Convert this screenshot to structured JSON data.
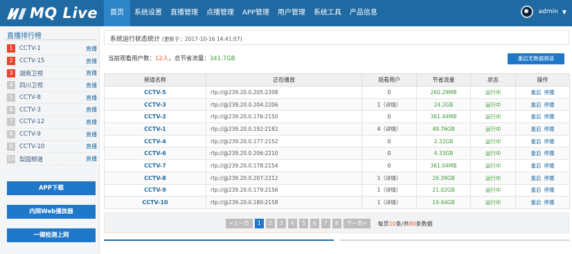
{
  "app": {
    "logo_text": "MQ Live"
  },
  "nav": {
    "items": [
      {
        "label": "首页",
        "active": true
      },
      {
        "label": "系统设置"
      },
      {
        "label": "直播管理"
      },
      {
        "label": "点播管理"
      },
      {
        "label": "APP管理"
      },
      {
        "label": "用户管理"
      },
      {
        "label": "系统工具"
      },
      {
        "label": "产品信息"
      }
    ],
    "username": "admin"
  },
  "sidebar": {
    "title": "直播排行榜",
    "ranks": [
      {
        "num": "1",
        "name": "CCTV-1",
        "link": "直播"
      },
      {
        "num": "2",
        "name": "CCTV-15",
        "link": "直播"
      },
      {
        "num": "3",
        "name": "湖南卫视",
        "link": "直播"
      },
      {
        "num": "4",
        "name": "四川卫视",
        "link": "直播"
      },
      {
        "num": "5",
        "name": "CCTV-8",
        "link": "直播"
      },
      {
        "num": "6",
        "name": "CCTV-3",
        "link": "直播"
      },
      {
        "num": "7",
        "name": "CCTV-12",
        "link": "直播"
      },
      {
        "num": "8",
        "name": "CCTV-9",
        "link": "直播"
      },
      {
        "num": "9",
        "name": "CCTV-10",
        "link": "直播"
      },
      {
        "num": "10",
        "name": "梨园频道",
        "link": "直播"
      }
    ],
    "buttons": [
      "APP下载",
      "内网Web播放器",
      "一键检测上网"
    ]
  },
  "main": {
    "title": "系统运行状态统计",
    "timestamp": "(更新于：2017-10-16 14:41:07)",
    "summary": {
      "prefix": "当前观看用户数：",
      "users": "12人",
      "mid": "，总节省流量：",
      "traffic": "341.7GB"
    },
    "restart_button": "重启无数据频道",
    "table": {
      "headers": [
        "频道名称",
        "正在播放",
        "观看用户",
        "节省流量",
        "状态",
        "操作"
      ],
      "rows": [
        {
          "channel": "CCTV-5",
          "url": "rtp://@239.20.0.205:2208",
          "users": "0",
          "traffic": "260.29MB",
          "status": "运行中"
        },
        {
          "channel": "CCTV-3",
          "url": "rtp://@239.20.0.204:2206",
          "users": "1（详情）",
          "traffic": "24.2GB",
          "status": "运行中"
        },
        {
          "channel": "CCTV-2",
          "url": "rtp://@239.20.0.176:2150",
          "users": "0",
          "traffic": "361.44MB",
          "status": "运行中"
        },
        {
          "channel": "CCTV-1",
          "url": "rtp://@239.20.0.192:2182",
          "users": "4（详情）",
          "traffic": "48.76GB",
          "status": "运行中"
        },
        {
          "channel": "CCTV-4",
          "url": "rtp://@239.20.0.177:2152",
          "users": "0",
          "traffic": "2.32GB",
          "status": "运行中"
        },
        {
          "channel": "CCTV-6",
          "url": "rtp://@239.20.0.206:2210",
          "users": "0",
          "traffic": "4.33GB",
          "status": "运行中"
        },
        {
          "channel": "CCTV-7",
          "url": "rtp://@239.20.0.178:2154",
          "users": "0",
          "traffic": "361.04MB",
          "status": "运行中"
        },
        {
          "channel": "CCTV-8",
          "url": "rtp://@239.20.0.207:2212",
          "users": "1（详情）",
          "traffic": "26.39GB",
          "status": "运行中"
        },
        {
          "channel": "CCTV-9",
          "url": "rtp://@239.20.0.179:2156",
          "users": "1（详情）",
          "traffic": "21.02GB",
          "status": "运行中"
        },
        {
          "channel": "CCTV-10",
          "url": "rtp://@239.20.0.180:2158",
          "users": "1（详情）",
          "traffic": "19.44GB",
          "status": "运行中"
        }
      ],
      "op_restart": "重启",
      "op_stop": "停播"
    },
    "pagination": {
      "prev": "<上一页",
      "pages": [
        "1",
        "2",
        "3",
        "4",
        "5",
        "6",
        "7",
        "8"
      ],
      "current": "1",
      "next": "下一页>",
      "info_prefix": "每页",
      "per_page": "10",
      "info_mid": "条/共",
      "total": "80",
      "info_suffix": "条数据"
    }
  },
  "colors": {
    "topbar": "#1f6aa3",
    "active_tab": "#2e86c9",
    "button": "#1f77c9",
    "hot_rank": "#e8442e",
    "ok_green": "#3c9a36",
    "accent_red": "#e25a2b"
  }
}
